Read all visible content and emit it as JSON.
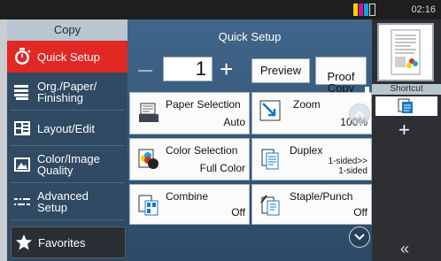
{
  "status_bar": {
    "time": "02:16",
    "toner_colors": [
      "#f5d300",
      "#d0109f",
      "#14a0e0",
      "#1e1e1e"
    ]
  },
  "left_menu": {
    "title": "Copy",
    "items": [
      {
        "label": "Quick Setup",
        "icon": "timer-icon",
        "active": true
      },
      {
        "label": "Org./Paper/\nFinishing",
        "icon": "paper-stack-icon",
        "active": false
      },
      {
        "label": "Layout/Edit",
        "icon": "layout-grid-icon",
        "active": false
      },
      {
        "label": "Color/Image\nQuality",
        "icon": "image-icon",
        "active": false
      },
      {
        "label": "Advanced\nSetup",
        "icon": "dashed-lines-icon",
        "active": false
      }
    ],
    "favorites_label": "Favorites"
  },
  "center": {
    "title": "Quick Setup",
    "copies": "1",
    "preview_label": "Preview",
    "proof_copy_label": "Proof\nCopy",
    "tiles": [
      {
        "title": "Paper Selection",
        "value": "Auto",
        "icon": "paper-tray-icon"
      },
      {
        "title": "Zoom",
        "value": "100%",
        "icon": "zoom-arrow-icon"
      },
      {
        "title": "Color Selection",
        "value": "Full Color",
        "icon": "color-select-icon"
      },
      {
        "title": "Duplex",
        "value": "1-sided>>\n1-sided",
        "icon": "duplex-icon"
      },
      {
        "title": "Combine",
        "value": "Off",
        "icon": "combine-icon"
      },
      {
        "title": "Staple/Punch",
        "value": "Off",
        "icon": "staple-icon"
      }
    ]
  },
  "right_panel": {
    "shortcut_label": "Shortcut",
    "add_label": "+",
    "collapse_label": "«"
  }
}
